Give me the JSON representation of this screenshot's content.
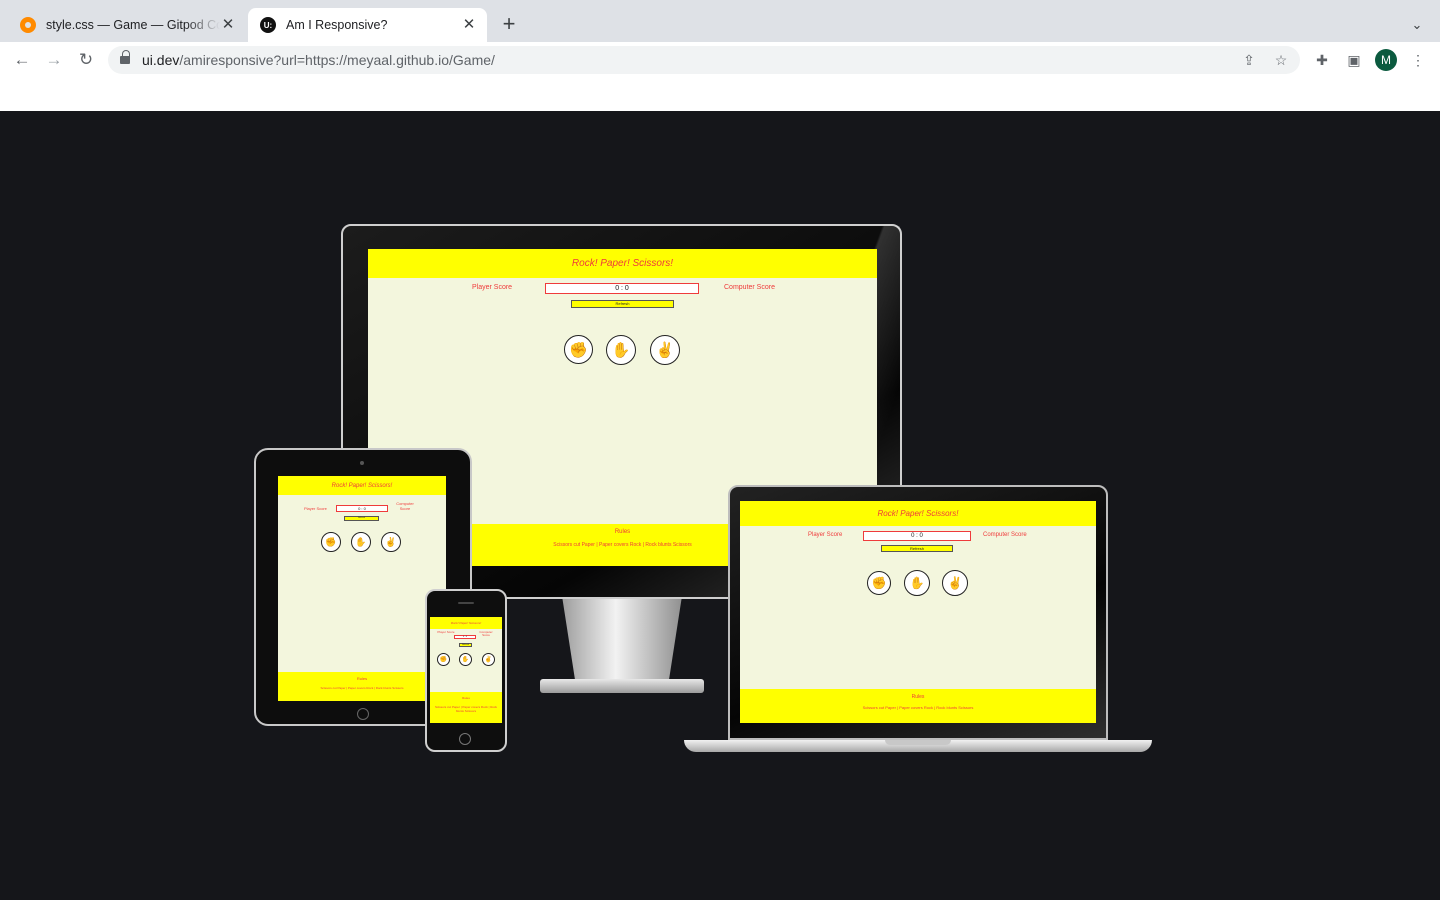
{
  "browser": {
    "tabs": [
      {
        "title": "style.css — Game — Gitpod Code",
        "favicon": "gitpod-icon",
        "active": false
      },
      {
        "title": "Am I Responsive?",
        "favicon": "uidev-icon",
        "favicon_text": "U:",
        "active": true
      }
    ],
    "new_tab_label": "+",
    "address": {
      "host": "ui.dev",
      "path": "/amiresponsive?url=https://meyaal.github.io/Game/"
    },
    "profile_initial": "M"
  },
  "game": {
    "title": "Rock!  Paper!  Scissors!",
    "player_score_label": "Player Score",
    "computer_score_label": "Computer Score",
    "score": "0 : 0",
    "refresh_label": "Refresh",
    "choices": [
      {
        "name": "rock",
        "icon": "✊"
      },
      {
        "name": "paper",
        "icon": "✋"
      },
      {
        "name": "scissors",
        "icon": "✌"
      }
    ],
    "rules_title": "Rules",
    "rules_text": "Scissors cut Paper | Paper covers Rock | Rock blunts Scissors"
  },
  "colors": {
    "page_bg": "#15161a",
    "game_header": "#ffff00",
    "game_bg": "#f3f6dd",
    "game_text": "#ef3b3b"
  }
}
